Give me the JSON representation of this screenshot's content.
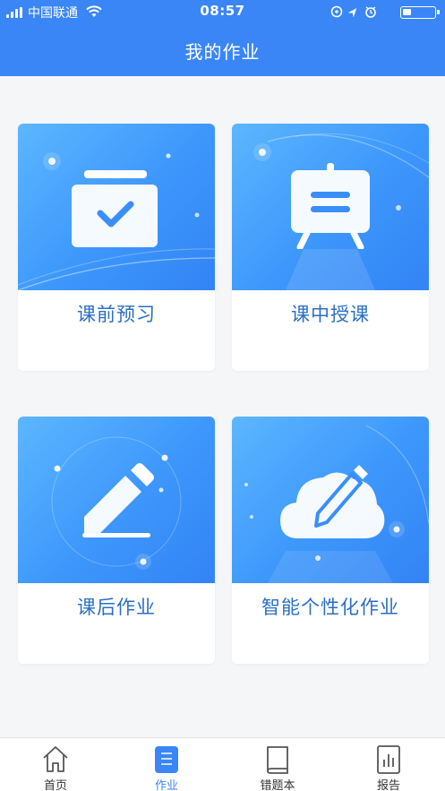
{
  "status_bar": {
    "carrier": "中国联通",
    "time": "08:57"
  },
  "header": {
    "title": "我的作业"
  },
  "cards": [
    {
      "label": "课前预习",
      "icon": "checklist-folder-icon"
    },
    {
      "label": "课中授课",
      "icon": "easel-board-icon"
    },
    {
      "label": "课后作业",
      "icon": "pencil-icon"
    },
    {
      "label": "智能个性化作业",
      "icon": "cloud-pencil-icon"
    }
  ],
  "tabbar": {
    "tabs": [
      {
        "label": "首页",
        "icon": "home-icon",
        "active": false
      },
      {
        "label": "作业",
        "icon": "list-icon",
        "active": true
      },
      {
        "label": "错题本",
        "icon": "book-icon",
        "active": false
      },
      {
        "label": "报告",
        "icon": "report-chart-icon",
        "active": false
      }
    ]
  },
  "colors": {
    "primary": "#3a86f7",
    "card_label": "#2a6fc4",
    "background": "#f5f6f8",
    "tab_inactive": "#333333"
  }
}
